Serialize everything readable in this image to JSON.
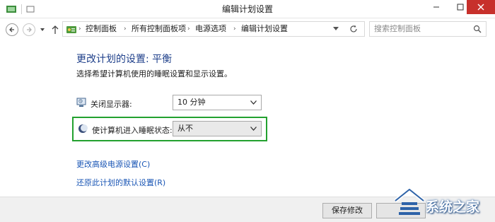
{
  "window": {
    "title": "编辑计划设置",
    "controls": {
      "minimize": "minimize-icon",
      "maximize": "maximize-icon",
      "close": "close-icon"
    }
  },
  "address_bar": {
    "crumbs": [
      "控制面板",
      "所有控制面板项",
      "电源选项",
      "编辑计划设置"
    ],
    "separator": "›"
  },
  "search": {
    "placeholder": "搜索控制面板"
  },
  "main": {
    "heading": "更改计划的设置: 平衡",
    "subtitle": "选择希望计算机使用的睡眠设置和显示设置。",
    "settings": [
      {
        "label": "关闭显示器:",
        "icon": "monitor-icon",
        "value": "10 分钟"
      },
      {
        "label": "使计算机进入睡眠状态:",
        "icon": "sleep-moon-icon",
        "value": "从不"
      }
    ],
    "highlight_color": "#23a12f",
    "links": [
      "更改高级电源设置(C)",
      "还原此计划的默认设置(R)"
    ]
  },
  "footer": {
    "save_label": "保存修改"
  },
  "watermark": {
    "text": "系统之家"
  },
  "colors": {
    "heading": "#1e3f8a",
    "link": "#1a56b5",
    "close_button": "#c7302b"
  }
}
